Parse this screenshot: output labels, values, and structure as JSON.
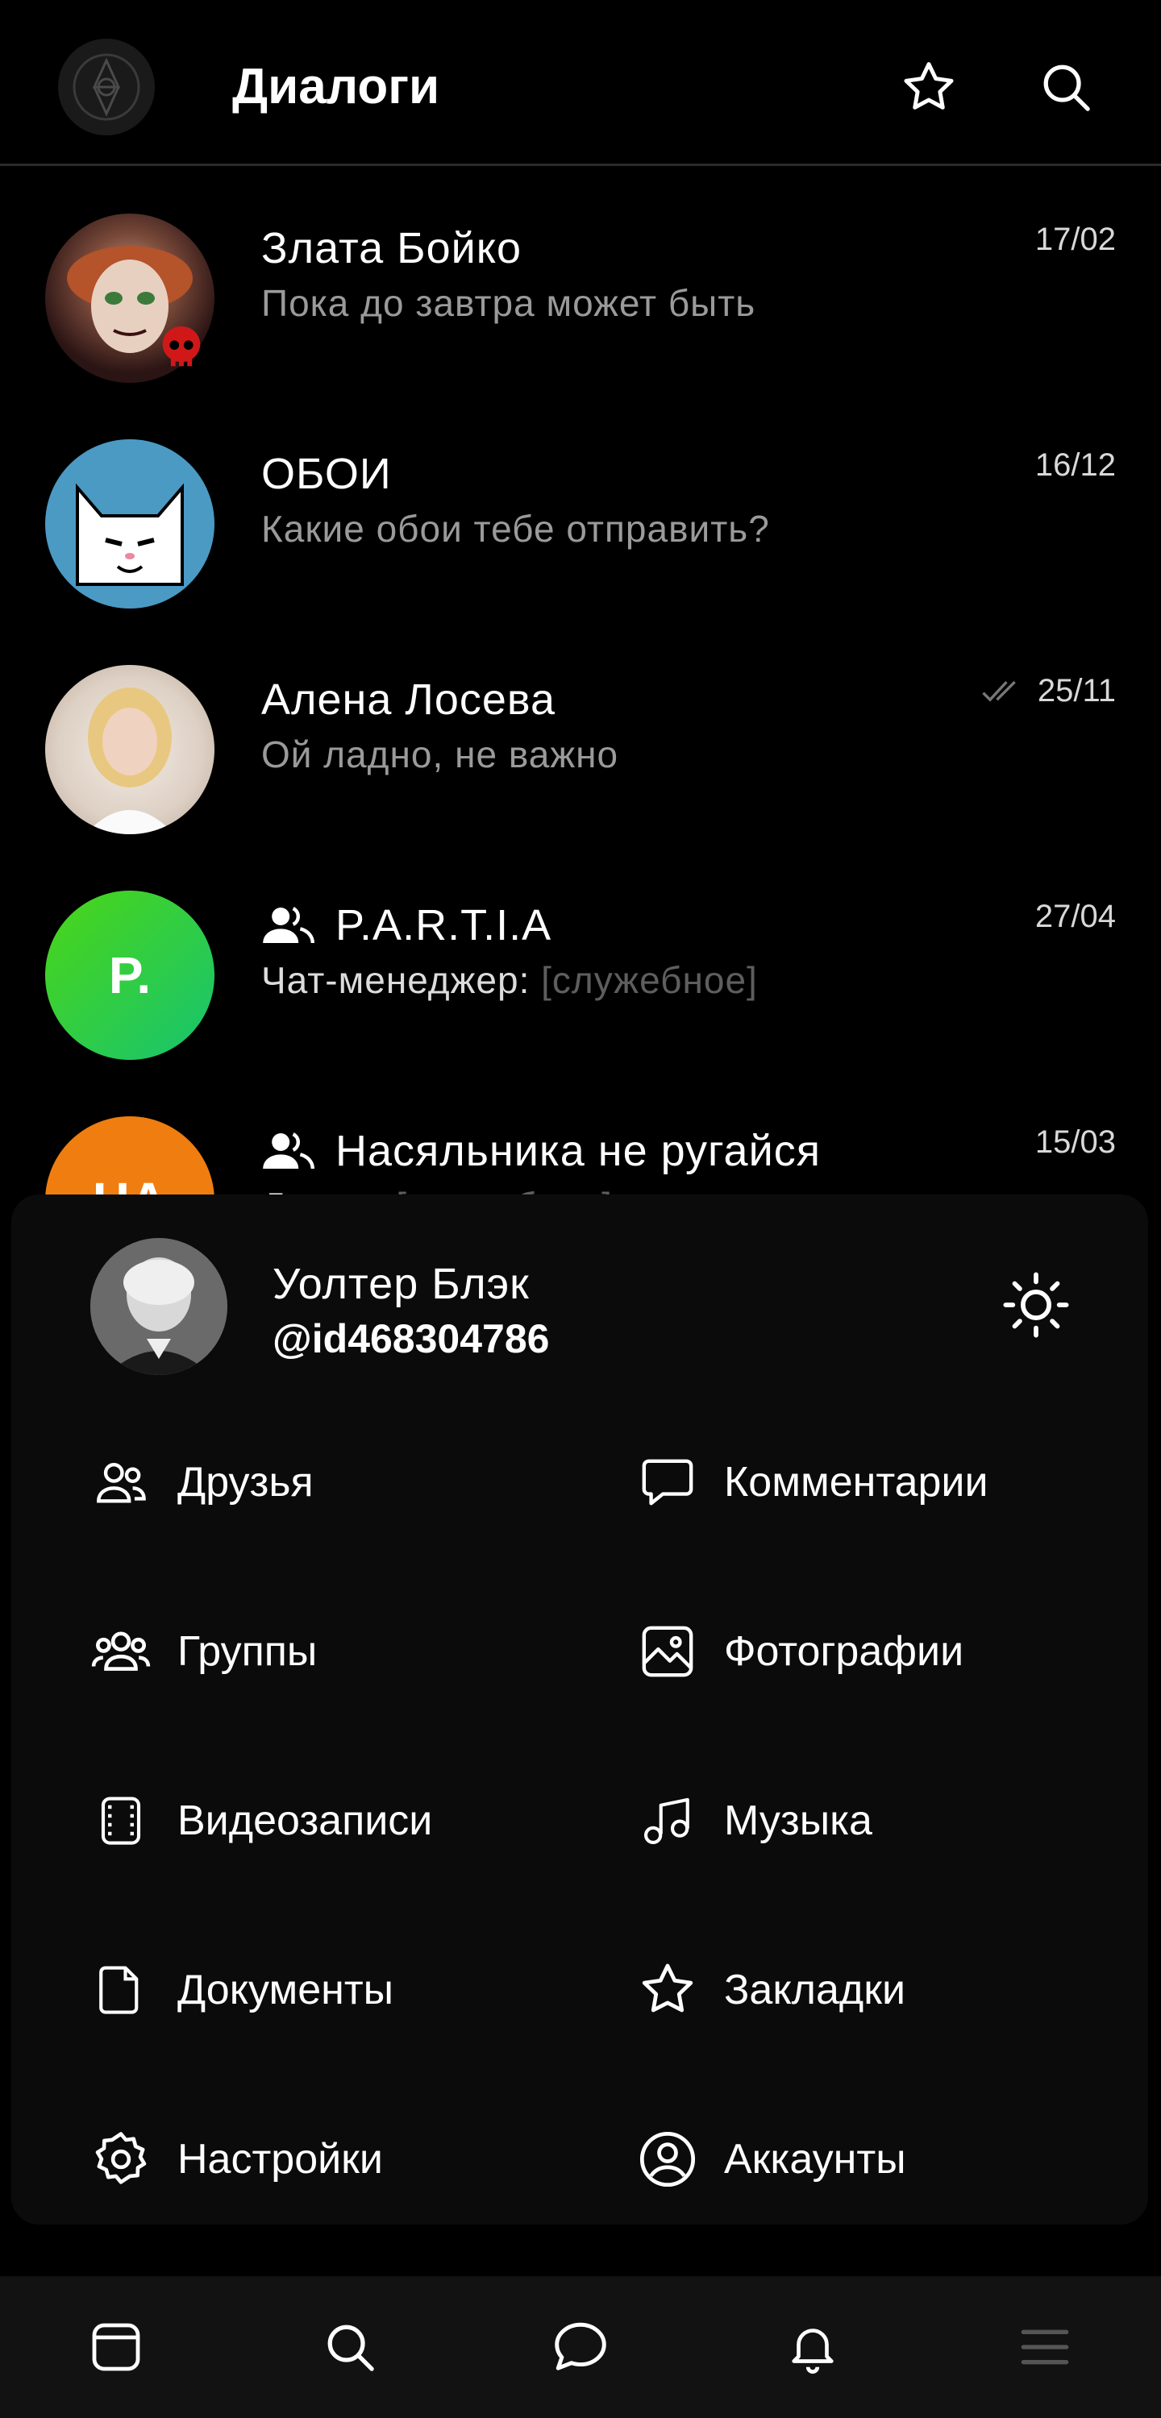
{
  "header": {
    "title": "Диалоги",
    "logo_icon": "triskelion-logo-icon",
    "actions": [
      "star-icon",
      "search-icon"
    ]
  },
  "dialogs": [
    {
      "name": "Злата Бойко",
      "message": "Пока   до завтра может быть",
      "date": "17/02",
      "avatar_color": "#3a1c1c",
      "group": false,
      "read_check": false
    },
    {
      "name": "ОБОИ",
      "message": "Какие обои тебе отправить?",
      "date": "16/12",
      "avatar_color": "#4a9ac4",
      "group": false,
      "read_check": false
    },
    {
      "name": "Алена Лосева",
      "message": "Ой ладно, не важно",
      "date": "25/11",
      "avatar_color": "#d8c9b8",
      "group": false,
      "read_check": true
    },
    {
      "name": "P.A.R.T.I.A",
      "sender": "Чат-менеджер:",
      "service": "[служебное]",
      "date": "27/04",
      "avatar_text": "P.",
      "avatar_color": "#2ecc40",
      "group": true,
      "read_check": false
    },
    {
      "name": "Насяльника не ругайся",
      "sender": "Данил:",
      "service": "[служебное]",
      "date": "15/03",
      "avatar_text": "НА",
      "avatar_color": "#f07d10",
      "group": true,
      "read_check": false
    }
  ],
  "drawer": {
    "user_name": "Уолтер Блэк",
    "user_id": "@id468304786",
    "theme_icon": "sun-icon",
    "menu": [
      {
        "label": "Друзья",
        "icon": "friends-icon"
      },
      {
        "label": "Комментарии",
        "icon": "comment-icon"
      },
      {
        "label": "Группы",
        "icon": "groups-icon"
      },
      {
        "label": "Фотографии",
        "icon": "photo-icon"
      },
      {
        "label": "Видеозаписи",
        "icon": "video-icon"
      },
      {
        "label": "Музыка",
        "icon": "music-icon"
      },
      {
        "label": "Документы",
        "icon": "document-icon"
      },
      {
        "label": "Закладки",
        "icon": "bookmark-star-icon"
      },
      {
        "label": "Настройки",
        "icon": "settings-icon"
      },
      {
        "label": "Аккаунты",
        "icon": "account-icon"
      }
    ]
  },
  "bottom_nav": [
    "newsfeed-icon",
    "search-icon",
    "messages-icon",
    "notifications-icon",
    "menu-icon"
  ],
  "colors": {
    "background": "#000000",
    "drawer": "#0b0b0b",
    "nav": "#121212",
    "secondary_text": "#9a9a9a",
    "service_text": "#5e5e5e"
  }
}
